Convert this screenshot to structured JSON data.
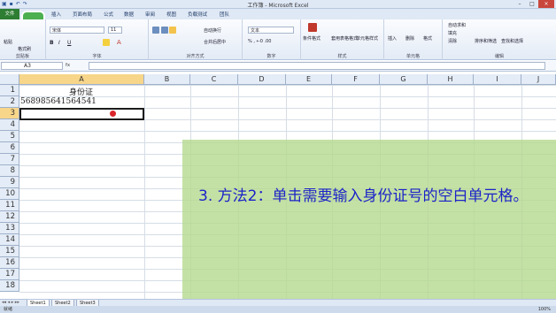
{
  "window": {
    "title": "工作簿 - Microsoft Excel",
    "buttons": [
      "–",
      "□",
      "×"
    ]
  },
  "ribbon_tabs": [
    {
      "label": "文件"
    },
    {
      "label": "开始"
    },
    {
      "label": "插入"
    },
    {
      "label": "页面布局"
    },
    {
      "label": "公式"
    },
    {
      "label": "数据"
    },
    {
      "label": "审阅"
    },
    {
      "label": "视图"
    },
    {
      "label": "负载测试"
    },
    {
      "label": "团队"
    }
  ],
  "ribbon": {
    "clipboard": {
      "paste": "粘贴",
      "format_painter": "格式刷",
      "label": "剪贴板"
    },
    "font": {
      "name": "宋体",
      "size": "11",
      "label": "字体"
    },
    "alignment": {
      "wrap": "自动换行",
      "merge": "合并后居中",
      "label": "对齐方式"
    },
    "number": {
      "format": "文本",
      "label": "数字"
    },
    "styles": {
      "conditional": "条件格式",
      "table": "套用表格格式",
      "cell": "单元格样式",
      "label": "样式"
    },
    "cells": {
      "insert": "插入",
      "delete": "删除",
      "format": "格式",
      "label": "单元格"
    },
    "editing": {
      "autosum": "自动求和",
      "fill": "填充",
      "clear": "清除",
      "sort": "排序和筛选",
      "find": "查找和选择",
      "label": "编辑"
    }
  },
  "formula_bar": {
    "name_box": "A3",
    "fx": "fx",
    "value": ""
  },
  "columns": [
    "A",
    "B",
    "C",
    "D",
    "E",
    "F",
    "G",
    "H",
    "I",
    "J"
  ],
  "rows": [
    "1",
    "2",
    "3",
    "4",
    "5",
    "6",
    "7",
    "8",
    "9",
    "10",
    "11",
    "12",
    "13",
    "14",
    "15",
    "16",
    "17",
    "18"
  ],
  "cells": {
    "A1": "身份证",
    "A2": "568985641564541"
  },
  "annotation": {
    "text": "3. 方法2：单击需要输入身份证号的空白单元格。",
    "color": "#1b23c8",
    "overlay_color": "#b4d88c"
  },
  "sheets": [
    "Sheet1",
    "Sheet2",
    "Sheet3"
  ],
  "status": {
    "mode": "就绪",
    "zoom": "100%"
  }
}
